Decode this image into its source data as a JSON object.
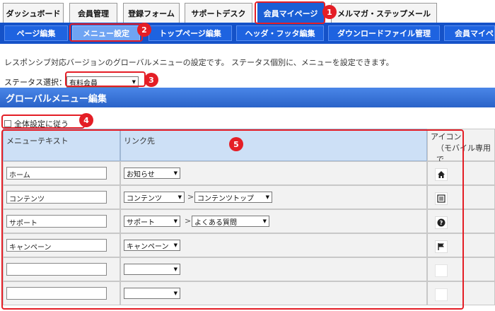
{
  "top_tabs": [
    "ダッシュボード",
    "会員管理",
    "登録フォーム",
    "サポートデスク",
    "会員マイページ",
    "メルマガ・ステップメール"
  ],
  "sub_tabs": [
    "ページ編集",
    "メニュー設定",
    "トップページ編集",
    "ヘッダ・フッタ編集",
    "ダウンロードファイル管理",
    "会員マイペ"
  ],
  "description": "レスポンシブ対応バージョンのグローバルメニューの設定です。 ステータス個別に、メニューを設定できます。",
  "status": {
    "label": "ステータス選択：",
    "value": "有料会員"
  },
  "section_title": "グローバルメニュー編集",
  "checkbox_label": "全体設定に従う",
  "table": {
    "headers": {
      "text": "メニューテキスト",
      "link": "リンク先",
      "icon": "アイコン",
      "icon_sub": "（モバイル専用で"
    },
    "rows": [
      {
        "text": "ホーム",
        "link1": "お知らせ",
        "link2": "",
        "icon": "home-icon"
      },
      {
        "text": "コンテンツ",
        "link1": "コンテンツ",
        "link2": "コンテンツトップ",
        "icon": "list-icon"
      },
      {
        "text": "サポート",
        "link1": "サポート",
        "link2": "よくある質問",
        "icon": "question-icon"
      },
      {
        "text": "キャンペーン",
        "link1": "キャンペーン",
        "link2": "",
        "icon": "flag-icon"
      },
      {
        "text": "",
        "link1": "",
        "link2": "",
        "icon": ""
      },
      {
        "text": "",
        "link1": "",
        "link2": "",
        "icon": ""
      }
    ]
  },
  "callouts": [
    "1",
    "2",
    "3",
    "4",
    "5"
  ],
  "colors": {
    "highlight": "#e41e26",
    "accent": "#1552c8"
  }
}
